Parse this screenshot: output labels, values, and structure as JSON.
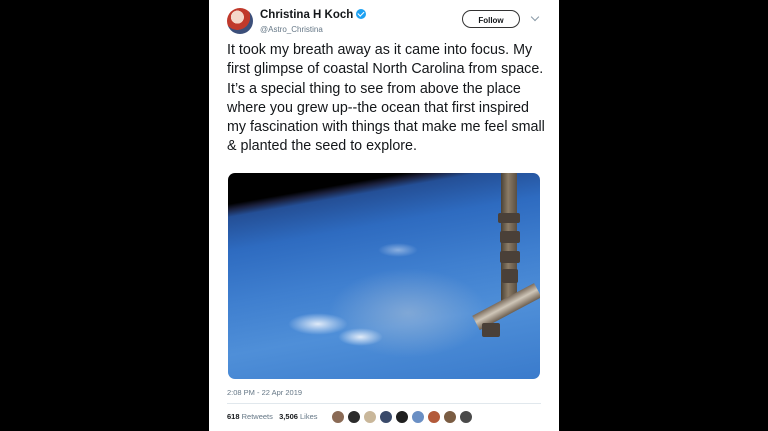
{
  "tweet": {
    "author_name": "Christina H Koch",
    "handle": "@Astro_Christina",
    "follow_label": "Follow",
    "text": "It took my breath away as it came into focus. My first glimpse of coastal North Carolina from space. It’s a special thing to see from above the place where you grew up--the ocean that first inspired my fascination with things that make me feel small & planted the seed to explore.",
    "timestamp": "2:08 PM - 22 Apr 2019",
    "retweets_count": "618",
    "retweets_label": "Retweets",
    "likes_count": "3,506",
    "likes_label": "Likes"
  },
  "colors": {
    "background": "#000000",
    "card": "#ffffff",
    "verified": "#1da1f2",
    "muted_text": "#657786",
    "primary_text": "#14171a"
  },
  "icons": [
    "verified-badge-icon",
    "chevron-down-icon"
  ],
  "liker_avatar_colors": [
    "#8a6a55",
    "#2b2b2b",
    "#c9b79a",
    "#3a4a6a",
    "#1f1f1f",
    "#6a8fc4",
    "#b35a3a",
    "#7a5c42",
    "#4a4a4a"
  ]
}
